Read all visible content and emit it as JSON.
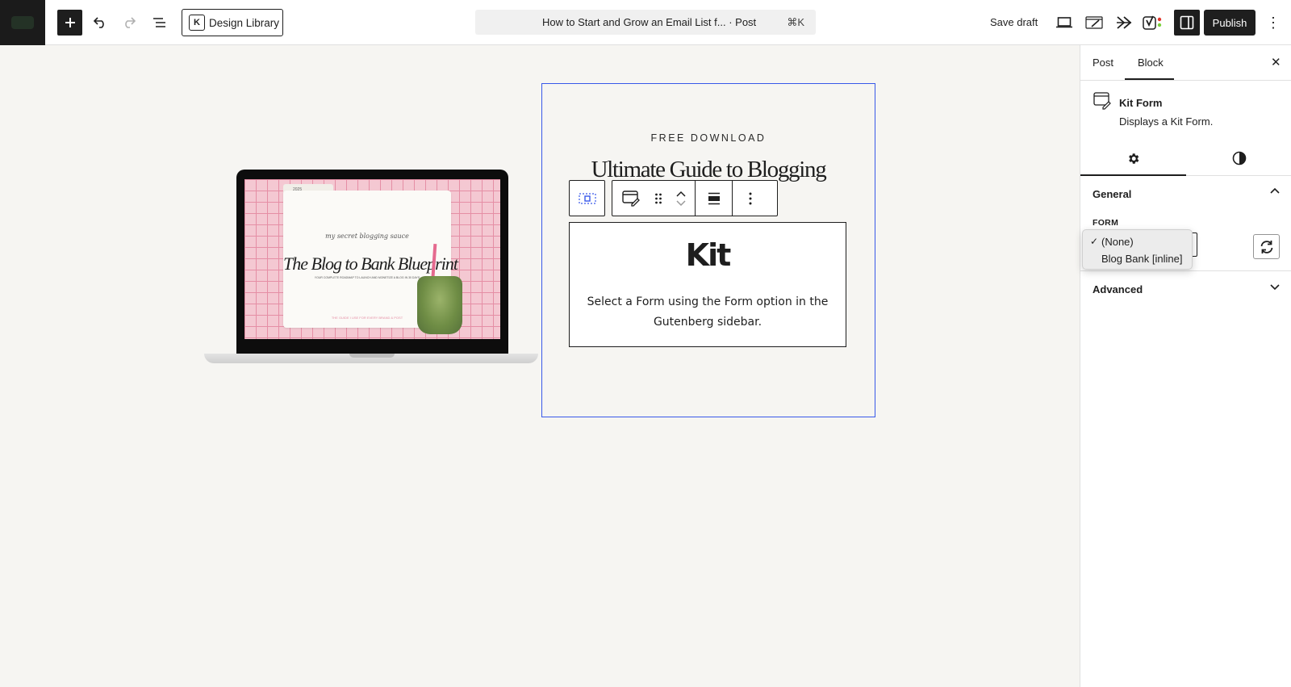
{
  "topbar": {
    "add_icon": "plus-icon",
    "undo_icon": "undo-icon",
    "redo_icon": "redo-icon",
    "document_overview_icon": "list-view-icon",
    "design_library_label": "Design Library",
    "document_title": "How to Start and Grow an Email List f... · Post",
    "command_shortcut": "⌘K",
    "save_draft_label": "Save draft",
    "publish_label": "Publish",
    "more_icon": "⋮"
  },
  "canvas": {
    "laptop_mockup": {
      "folder_tab": "2025",
      "script_text": "my secret blogging sauce",
      "title": "The Blog to Bank Blueprint",
      "subtitle": "YOUR COMPLETE ROADMAP TO LAUNCH AND MONETIZE A BLOG IN 30 DAYS",
      "footer": "THE GUIDE I USE FOR EVERY BRAND & POST"
    },
    "eyebrow": "FREE DOWNLOAD",
    "heading": "Ultimate Guide to Blogging",
    "kit_block": {
      "logo_text": "Kit",
      "message": "Select a Form using the Form option in the Gutenberg sidebar."
    }
  },
  "sidebar": {
    "tabs": [
      {
        "label": "Post",
        "active": false
      },
      {
        "label": "Block",
        "active": true
      }
    ],
    "close_icon": "✕",
    "block_card": {
      "title": "Kit Form",
      "description": "Displays a Kit Form."
    },
    "panels": {
      "general": {
        "title": "General",
        "form_label": "FORM"
      },
      "advanced": {
        "title": "Advanced"
      }
    },
    "form_dropdown": {
      "options": [
        "(None)",
        "Blog Bank [inline]"
      ],
      "selected": "(None)",
      "check": "✓"
    }
  },
  "colors": {
    "accent": "#3858e9",
    "dark": "#1e1e1e",
    "canvas_bg": "#f6f5f2",
    "grid_pink": "#f4c8d2"
  }
}
